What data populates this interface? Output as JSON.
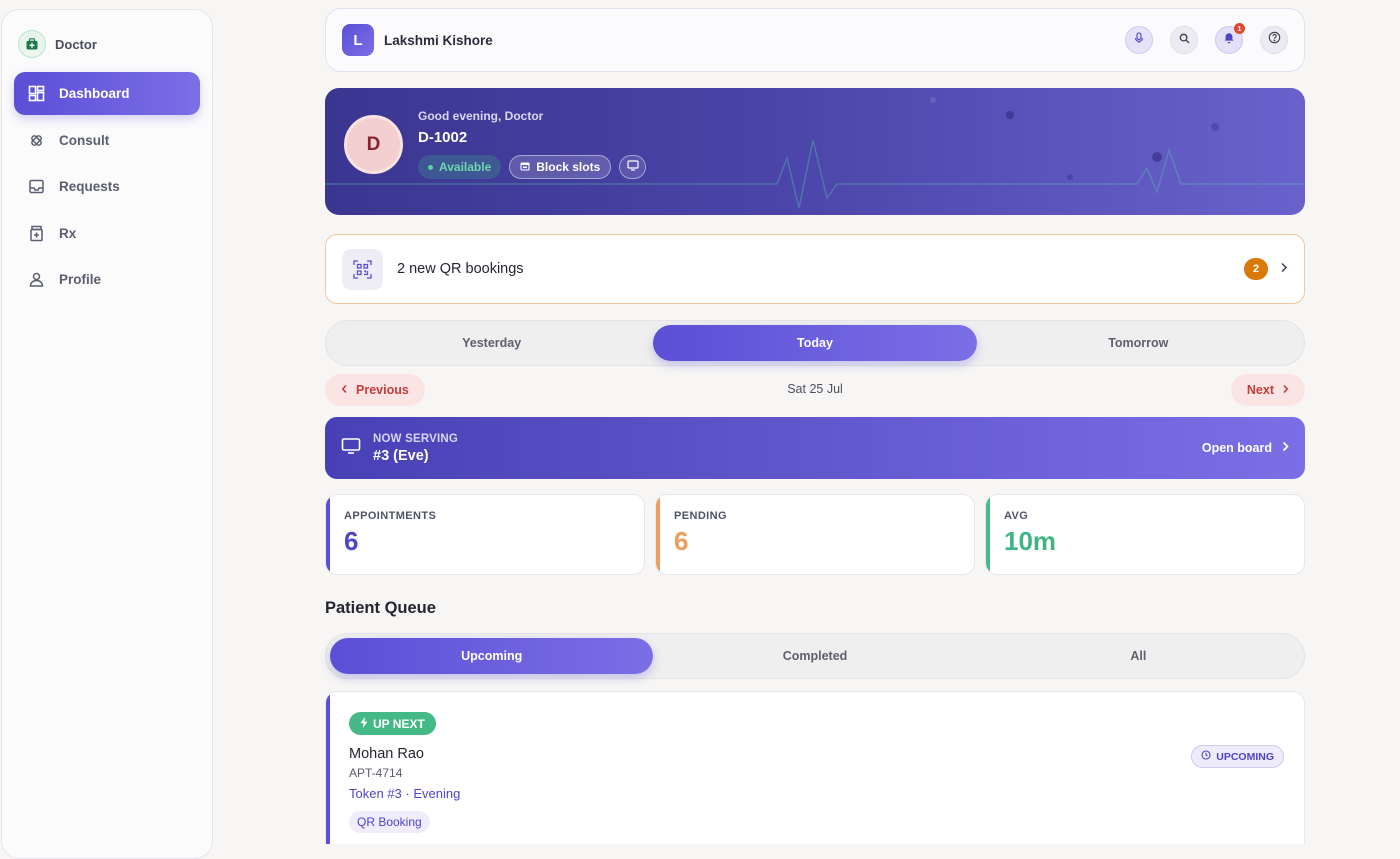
{
  "sidebar": {
    "brand": "Doctor",
    "items": [
      {
        "label": "Dashboard",
        "icon": "dashboard-icon",
        "active": true
      },
      {
        "label": "Consult",
        "icon": "bandage-icon",
        "active": false
      },
      {
        "label": "Requests",
        "icon": "inbox-icon",
        "active": false
      },
      {
        "label": "Rx",
        "icon": "medicine-icon",
        "active": false
      },
      {
        "label": "Profile",
        "icon": "user-icon",
        "active": false
      }
    ]
  },
  "topbar": {
    "avatar_letter": "L",
    "user_name": "Lakshmi Kishore",
    "notification_count": "1",
    "actions": [
      "mic-icon",
      "search-icon",
      "bell-icon",
      "help-icon"
    ]
  },
  "hero": {
    "avatar_letter": "D",
    "greeting": "Good evening, Doctor",
    "doctor_id": "D-1002",
    "status": "Available",
    "block_slots": "Block slots"
  },
  "qr_bookings": {
    "text": "2 new QR bookings",
    "count": "2"
  },
  "day_tabs": [
    {
      "label": "Yesterday",
      "active": false
    },
    {
      "label": "Today",
      "active": true
    },
    {
      "label": "Tomorrow",
      "active": false
    }
  ],
  "date_nav": {
    "previous": "Previous",
    "date": "Sat 25 Jul",
    "next": "Next"
  },
  "now_serving": {
    "label": "NOW SERVING",
    "value": "#3 (Eve)",
    "open_board": "Open board"
  },
  "stats": [
    {
      "label": "APPOINTMENTS",
      "value": "6"
    },
    {
      "label": "PENDING",
      "value": "6"
    },
    {
      "label": "AVG",
      "value": "10m"
    }
  ],
  "queue": {
    "title": "Patient Queue",
    "tabs": [
      {
        "label": "Upcoming",
        "active": true
      },
      {
        "label": "Completed",
        "active": false
      },
      {
        "label": "All",
        "active": false
      }
    ],
    "patients": [
      {
        "badge": "UP NEXT",
        "name": "Mohan Rao",
        "appointment_id": "APT-4714",
        "token": "Token #3 · Evening",
        "tag": "QR Booking",
        "status": "UPCOMING"
      }
    ]
  },
  "colors": {
    "accent": "#5a4fd6",
    "accent_light": "#7b6fe6",
    "success": "#45b985",
    "warning": "#ef9d5c",
    "danger": "#c63b3b"
  }
}
